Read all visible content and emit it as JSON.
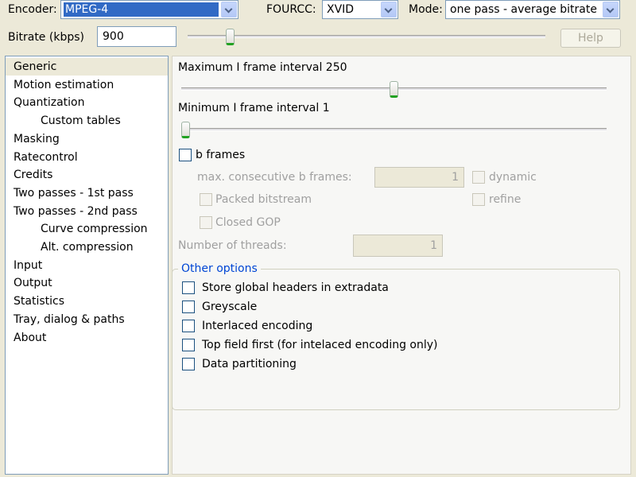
{
  "toolbar": {
    "encoder_label": "Encoder:",
    "encoder_value": "MPEG-4",
    "fourcc_label": "FOURCC:",
    "fourcc_value": "XVID",
    "mode_label": "Mode:",
    "mode_value": "one pass - average bitrate",
    "bitrate_label": "Bitrate (kbps)",
    "bitrate_value": "900",
    "bitrate_slider_fraction": 0.11,
    "help_label": "Help"
  },
  "sidebar": {
    "items": [
      {
        "label": "Generic"
      },
      {
        "label": "Motion estimation"
      },
      {
        "label": "Quantization"
      },
      {
        "label": "Custom tables"
      },
      {
        "label": "Masking"
      },
      {
        "label": "Ratecontrol"
      },
      {
        "label": "Credits"
      },
      {
        "label": "Two passes - 1st pass"
      },
      {
        "label": "Two passes - 2nd pass"
      },
      {
        "label": "Curve compression"
      },
      {
        "label": "Alt. compression"
      },
      {
        "label": "Input"
      },
      {
        "label": "Output"
      },
      {
        "label": "Statistics"
      },
      {
        "label": "Tray, dialog & paths"
      },
      {
        "label": "About"
      }
    ],
    "selected": "Generic"
  },
  "generic": {
    "max_i_frame_label": "Maximum I frame interval 250",
    "max_i_frame_slider_fraction": 0.5,
    "min_i_frame_label": "Minimum I frame interval 1",
    "min_i_frame_slider_fraction": 0.0,
    "b_frames_label": "b frames",
    "max_consecutive_label": "max. consecutive b frames:",
    "max_consecutive_value": "1",
    "dynamic_label": "dynamic",
    "packed_bitstream_label": "Packed bitstream",
    "refine_label": "refine",
    "closed_gop_label": "Closed GOP",
    "threads_label": "Number of threads:",
    "threads_value": "1"
  },
  "other_options": {
    "title": "Other options",
    "store_global_headers": "Store global headers in extradata",
    "greyscale": "Greyscale",
    "interlaced": "Interlaced encoding",
    "top_field_first": "Top field first (for intelaced encoding only)",
    "data_partitioning": "Data partitioning"
  }
}
